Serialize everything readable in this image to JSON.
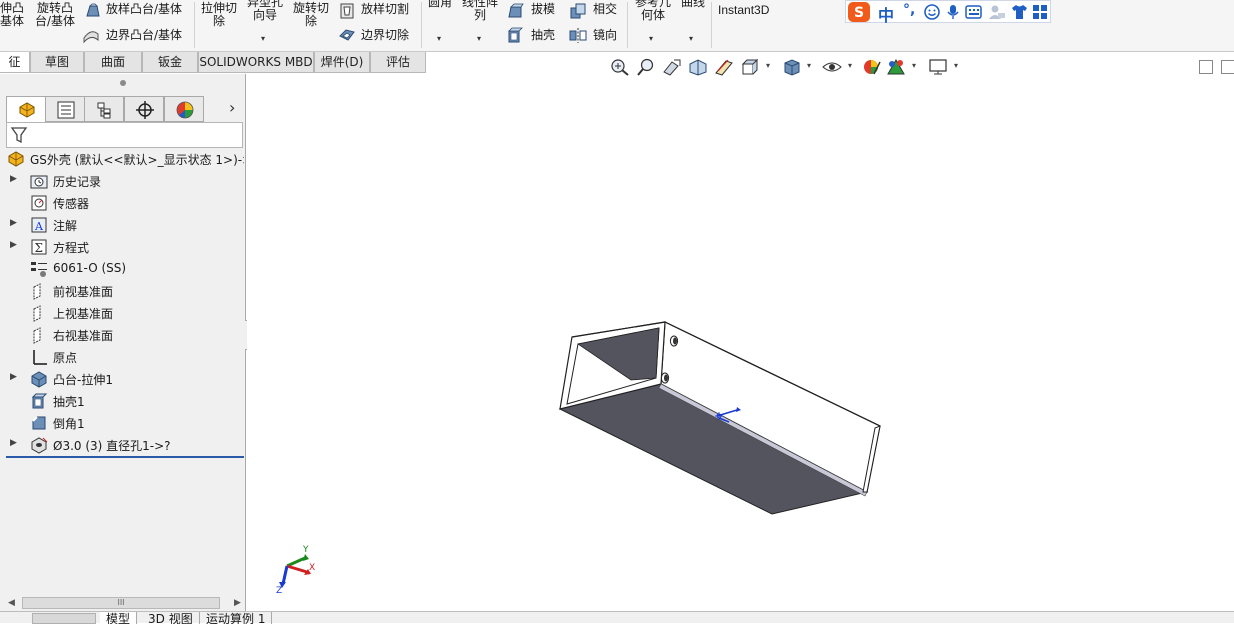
{
  "ribbon": {
    "extrude_boss": "伸凸\n基体",
    "revolve_boss": "旋转凸\n台/基体",
    "loft_boss": "放样凸台/基体",
    "boundary_boss": "边界凸台/基体",
    "extrude_cut": "拉伸切\n除",
    "hole_wizard": "异型孔\n向导",
    "revolve_cut": "旋转切\n除",
    "loft_cut": "放样切割",
    "boundary_cut": "边界切除",
    "fillet": "圆角",
    "linear_pattern": "线性阵\n列",
    "draft": "拔模",
    "shell": "抽壳",
    "intersect": "相交",
    "mirror": "镜向",
    "ref_geometry": "参考几\n何体",
    "curves": "曲线",
    "instant3d": "Instant3D"
  },
  "ime": {
    "chinese": "中",
    "punct": "°,"
  },
  "tabs": [
    "征",
    "草图",
    "曲面",
    "钣金",
    "SOLIDWORKS MBD",
    "焊件(D)",
    "评估"
  ],
  "feature_tree": {
    "root": "GS外壳  (默认<<默认>_显示状态 1>)->",
    "items": [
      {
        "label": "历史记录",
        "expandable": true,
        "icon": "history-folder-icon"
      },
      {
        "label": "传感器",
        "expandable": false,
        "icon": "sensor-icon"
      },
      {
        "label": "注解",
        "expandable": true,
        "icon": "annotation-icon"
      },
      {
        "label": "方程式",
        "expandable": true,
        "icon": "equation-icon"
      },
      {
        "label": "6061-O (SS)",
        "expandable": false,
        "icon": "material-icon"
      },
      {
        "label": "前视基准面",
        "expandable": false,
        "icon": "plane-icon"
      },
      {
        "label": "上视基准面",
        "expandable": false,
        "icon": "plane-icon"
      },
      {
        "label": "右视基准面",
        "expandable": false,
        "icon": "plane-icon"
      },
      {
        "label": "原点",
        "expandable": false,
        "icon": "origin-icon"
      },
      {
        "label": "凸台-拉伸1",
        "expandable": true,
        "icon": "extrude-feature-icon"
      },
      {
        "label": "抽壳1",
        "expandable": false,
        "icon": "shell-feature-icon"
      },
      {
        "label": "倒角1",
        "expandable": false,
        "icon": "chamfer-feature-icon"
      },
      {
        "label": "Ø3.0 (3) 直径孔1->?",
        "expandable": true,
        "icon": "hole-feature-icon"
      }
    ]
  },
  "scrollbar_label": "III",
  "triad": {
    "x": "X",
    "y": "Y",
    "z": "Z"
  },
  "bottom_tabs": [
    "模型",
    "3D 视图",
    "运动算例 1"
  ],
  "colors": {
    "tree_accent": "#2a5aa8",
    "model_face": "#54545e",
    "triad_x": "#d02020",
    "triad_y": "#1a8a1a",
    "triad_z": "#1a3ad0"
  }
}
